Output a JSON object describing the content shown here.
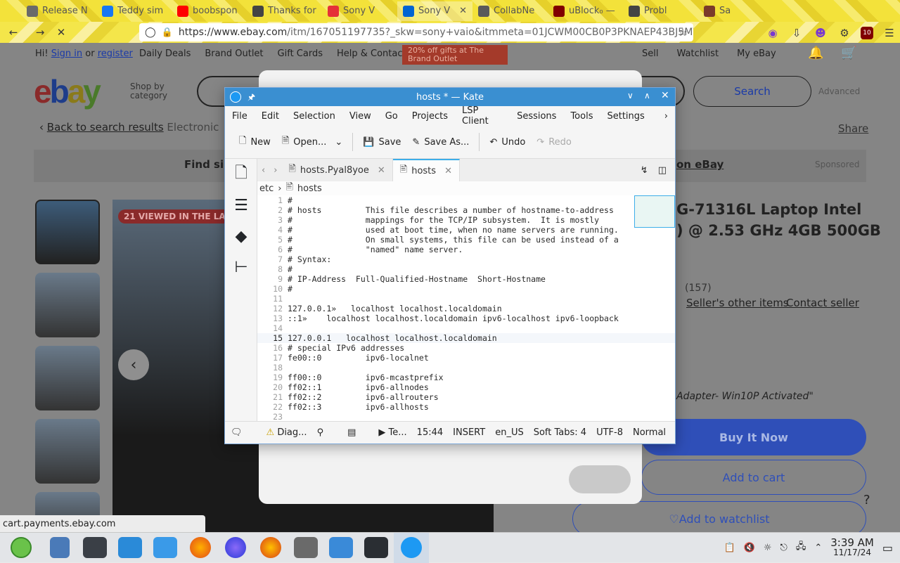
{
  "browser": {
    "tabs": [
      {
        "label": "Release N",
        "fav_color": "#6a6a6a"
      },
      {
        "label": "Teddy sim",
        "fav_color": "#1877f2"
      },
      {
        "label": "boobspon",
        "fav_color": "#ff0000"
      },
      {
        "label": "Thanks for",
        "fav_color": "#444444"
      },
      {
        "label": "Sony V",
        "fav_color": "#e53238"
      },
      {
        "label": "Sony V",
        "fav_color": "#0064d2"
      },
      {
        "label": "CollabNe",
        "fav_color": "#5a5a5a"
      },
      {
        "label": "uBlock₀ —",
        "fav_color": "#800000"
      },
      {
        "label": "Probl",
        "fav_color": "#444444"
      },
      {
        "label": "Sa",
        "fav_color": "#7a3a2a"
      }
    ],
    "url_host": "https://www.ebay.com",
    "url_rest": "/itm/167051197735?_skw=sony+vaio&itmmeta=01JCWM00CB0P3PKNAEP43BJ5MY&h",
    "ublock_count": "10",
    "status_url": "cart.payments.ebay.com"
  },
  "ebay": {
    "greeting": "Hi!",
    "sign_in": "Sign in",
    "or": "or",
    "register": "register",
    "top_links": [
      "Daily Deals",
      "Brand Outlet",
      "Gift Cards",
      "Help & Contact"
    ],
    "promo": "20% off gifts at The Brand Outlet",
    "right_links": [
      "Sell",
      "Watchlist",
      "My eBay"
    ],
    "logo": "ebay",
    "shop_by": "Shop by",
    "category": "category",
    "search_button": "Search",
    "advanced": "Advanced",
    "back": "Back to search results",
    "breadcrumb_part": "Electronic",
    "share": "Share",
    "find_similar": "Find simi",
    "on_ebay": "on eBay",
    "sponsored": "Sponsored",
    "viewed": "21 VIEWED IN THE LAST",
    "title": "G-71316L Laptop Intel\n) @ 2.53 GHz 4GB 500GB",
    "feedback_count": "(157)",
    "sellers_items": "Seller's other items",
    "contact_seller": "Contact seller",
    "condition_note": "Adapter- Win10P Activated\"",
    "buy_now": "Buy It Now",
    "add_cart": "Add to cart",
    "add_watch": "♡Add to watchlist"
  },
  "kate": {
    "title": "hosts * — Kate",
    "menu": [
      "File",
      "Edit",
      "Selection",
      "View",
      "Go",
      "Projects",
      "LSP Client",
      "Sessions",
      "Tools",
      "Settings"
    ],
    "toolbar": {
      "new": "New",
      "open": "Open...",
      "save": "Save",
      "save_as": "Save As...",
      "undo": "Undo",
      "redo": "Redo"
    },
    "tabs": [
      "hosts.Pyal8yoe",
      "hosts"
    ],
    "breadcrumb": [
      "etc",
      "hosts"
    ],
    "lines": [
      "#",
      "# hosts         This file describes a number of hostname-to-address",
      "#               mappings for the TCP/IP subsystem.  It is mostly",
      "#               used at boot time, when no name servers are running.",
      "#               On small systems, this file can be used instead of a",
      "#               \"named\" name server.",
      "# Syntax:",
      "#",
      "# IP-Address  Full-Qualified-Hostname  Short-Hostname",
      "#",
      "",
      "127.0.0.1»   localhost localhost.localdomain",
      "::1»    localhost localhost.localdomain ipv6-localhost ipv6-loopback",
      "",
      "127.0.0.1   localhost localhost.localdomain",
      "# special IPv6 addresses",
      "fe00::0         ipv6-localnet",
      "",
      "ff00::0         ipv6-mcastprefix",
      "ff02::1         ipv6-allnodes",
      "ff02::2         ipv6-allrouters",
      "ff02::3         ipv6-allhosts",
      ""
    ],
    "current_line": 15,
    "status": {
      "diag": "Diag...",
      "terminal": "Te...",
      "position": "15:44",
      "mode": "INSERT",
      "lang": "en_US",
      "tabs": "Soft Tabs: 4",
      "encoding": "UTF-8",
      "input": "Normal"
    }
  },
  "taskbar": {
    "time": "3:39 AM",
    "date": "11/17/24"
  },
  "colors": {
    "kate_title": "#3a8fd1",
    "ebay_blue": "#3665f3",
    "accent": "#3daee9"
  }
}
